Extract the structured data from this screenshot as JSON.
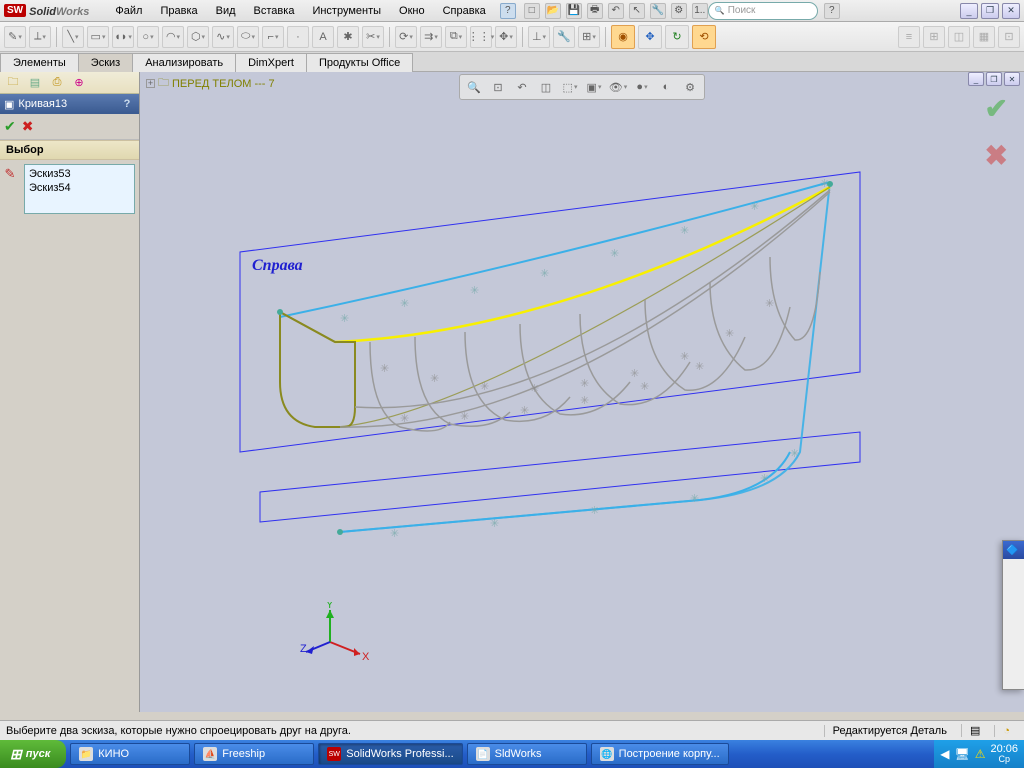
{
  "app": {
    "logo_badge": "SW",
    "logo_bold": "Solid",
    "logo_light": "Works"
  },
  "menu": [
    "Файл",
    "Правка",
    "Вид",
    "Вставка",
    "Инструменты",
    "Окно",
    "Справка"
  ],
  "search": {
    "placeholder": "Поиск"
  },
  "cmdtabs": [
    "Элементы",
    "Эскиз",
    "Анализировать",
    "DimXpert",
    "Продукты Office"
  ],
  "active_cmdtab": 1,
  "feature_panel": {
    "title": "Кривая13",
    "section": "Выбор",
    "items": [
      "Эскиз53",
      "Эскиз54"
    ]
  },
  "breadcrumb": {
    "label": "ПЕРЕД ТЕЛОМ --- 7"
  },
  "plane_label": "Справа",
  "status": {
    "left": "Выберите два эскиза, которые нужно спроецировать друг на друга.",
    "right": "Редактируется Деталь"
  },
  "taskbar": {
    "start": "пуск",
    "items": [
      {
        "label": "КИНО",
        "icon": "📁"
      },
      {
        "label": "Freeship",
        "icon": "⛵"
      },
      {
        "label": "SolidWorks Professi...",
        "icon": "SW",
        "active": true
      },
      {
        "label": "SldWorks",
        "icon": "📄"
      },
      {
        "label": "Построение корпу...",
        "icon": "🌐"
      }
    ],
    "clock_time": "20:06",
    "clock_day": "Ср"
  },
  "triad": {
    "x": "X",
    "y": "Y",
    "z": "Z"
  }
}
